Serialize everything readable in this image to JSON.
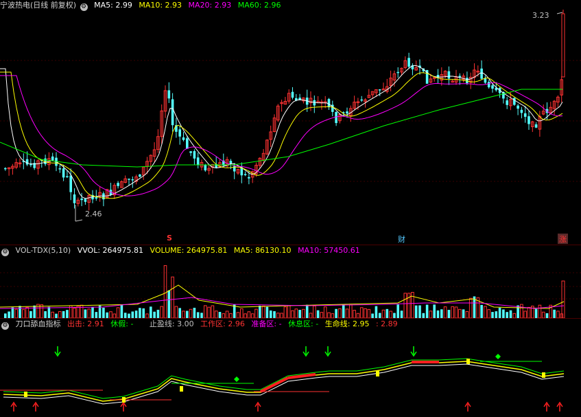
{
  "main": {
    "stock_title": "宁波热电(日线 前复权)",
    "ma5_label": "MA5:",
    "ma5_value": "2.99",
    "ma10_label": "MA10:",
    "ma10_value": "2.93",
    "ma20_label": "MA20:",
    "ma20_value": "2.93",
    "ma60_label": "MA60:",
    "ma60_value": "2.96",
    "high_price_label": "3.23",
    "low_price_label": "2.46",
    "markers": [
      "S",
      "财",
      "涨"
    ]
  },
  "volume": {
    "title": "VOL-TDX(5,10)",
    "vvol_label": "VVOL:",
    "vvol_value": "264975.81",
    "volume_label": "VOLUME:",
    "volume_value": "264975.81",
    "ma5_label": "MA5:",
    "ma5_value": "86130.10",
    "ma10_label": "MA10:",
    "ma10_value": "57450.61"
  },
  "indicator": {
    "title": "刀口舔血指标",
    "out_label": "出击:",
    "out_value": "2.91",
    "rest_label": "休假:",
    "rest_value": "-",
    "stop_label": "止盈线:",
    "stop_value": "3.00",
    "work_label": "工作区:",
    "work_value": "2.96",
    "prep_label": "准备区:",
    "prep_value": "-",
    "break_label": "休息区:",
    "break_value": "-",
    "life_label": "生命线:",
    "life_value": "2.95",
    "extra_value": ": 2.89"
  },
  "colors": {
    "up": "#ff3232",
    "down": "#54ffff",
    "ma5": "#ffffff",
    "ma10": "#ffff00",
    "ma20": "#ff00ff",
    "ma60": "#00ff00",
    "bg": "#000000",
    "grid": "#5a0000"
  },
  "chart_data": {
    "type": "candlestick",
    "ylim": [
      2.46,
      3.23
    ],
    "series": [
      {
        "name": "MA5",
        "values": [
          2.99
        ]
      },
      {
        "name": "MA10",
        "values": [
          2.93
        ]
      },
      {
        "name": "MA20",
        "values": [
          2.93
        ]
      },
      {
        "name": "MA60",
        "values": [
          2.96
        ]
      }
    ],
    "annotations": [
      "3.23",
      "2.46"
    ]
  }
}
